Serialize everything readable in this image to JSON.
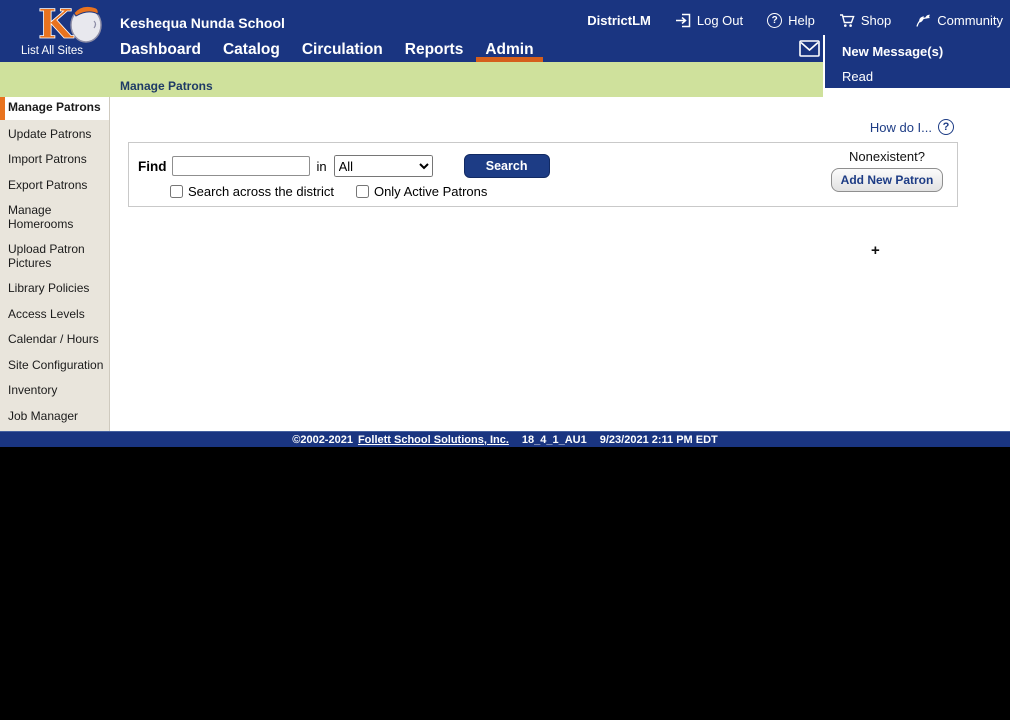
{
  "header": {
    "logo_letter": "K",
    "list_all_sites": "List All Sites",
    "school_name": "Keshequa Nunda School",
    "nav_tabs": [
      {
        "label": "Dashboard",
        "active": false
      },
      {
        "label": "Catalog",
        "active": false
      },
      {
        "label": "Circulation",
        "active": false
      },
      {
        "label": "Reports",
        "active": false
      },
      {
        "label": "Admin",
        "active": true
      }
    ],
    "utility": {
      "district_label": "DistrictLM",
      "logout_label": "Log Out",
      "help_label": "Help",
      "shop_label": "Shop",
      "community_label": "Community"
    },
    "messages": {
      "new_label": "New Message(s)",
      "read_label": "Read"
    }
  },
  "breadcrumb": "Manage Patrons",
  "sidebar": {
    "items": [
      {
        "label": "Manage Patrons",
        "active": true
      },
      {
        "label": "Update Patrons",
        "active": false
      },
      {
        "label": "Import Patrons",
        "active": false
      },
      {
        "label": "Export Patrons",
        "active": false
      },
      {
        "label": "Manage Homerooms",
        "active": false
      },
      {
        "label": "Upload Patron Pictures",
        "active": false
      },
      {
        "label": "Library Policies",
        "active": false
      },
      {
        "label": "Access Levels",
        "active": false
      },
      {
        "label": "Calendar / Hours",
        "active": false
      },
      {
        "label": "Site Configuration",
        "active": false
      },
      {
        "label": "Inventory",
        "active": false
      },
      {
        "label": "Job Manager",
        "active": false
      }
    ]
  },
  "main": {
    "how_do_i_label": "How do I...",
    "search_panel": {
      "find_label": "Find",
      "find_value": "",
      "in_label": "in",
      "scope_selected": "All",
      "search_button_label": "Search",
      "district_checkbox_label": "Search across the district",
      "active_checkbox_label": "Only Active Patrons",
      "nonexistent_label": "Nonexistent?",
      "add_new_patron_label": "Add New Patron"
    },
    "cursor_glyph": "+"
  },
  "icons": {
    "question_glyph": "?"
  },
  "footer": {
    "copyright": "©2002-2021",
    "company_link": "Follett School Solutions, Inc.",
    "version": "18_4_1_AU1",
    "timestamp": "9/23/2021 2:11 PM EDT"
  },
  "colors": {
    "header_navy": "#1a3581",
    "footer_navy": "#1a3581",
    "accent_orange": "#e8731f",
    "tab_underline_orange": "#d55f1c",
    "green_bar": "#cfe19c",
    "sidebar_bg": "#e9e5dc",
    "button_navy": "#1d3c85"
  }
}
